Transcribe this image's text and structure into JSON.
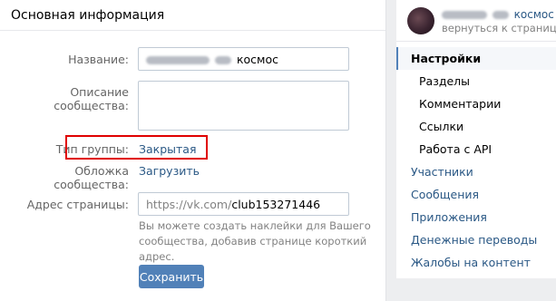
{
  "main": {
    "title": "Основная информация",
    "name_label": "Название:",
    "name_value_suffix": "космос",
    "description_label": "Описание сообщества:",
    "description_value": "",
    "group_type_label": "Тип группы:",
    "group_type_value": "Закрытая",
    "cover_label": "Обложка сообщества:",
    "cover_link": "Загрузить",
    "address_label": "Адрес страницы:",
    "address_prefix": "https://vk.com/",
    "address_value": "club153271446",
    "address_hint": "Вы можете создать наклейки для Вашего сообщества, добавив странице короткий адрес.",
    "save_label": "Сохранить"
  },
  "sidebar": {
    "community_name_suffix": "космос",
    "back_label": "вернуться к странице",
    "items": [
      {
        "label": "Настройки"
      },
      {
        "label": "Разделы"
      },
      {
        "label": "Комментарии"
      },
      {
        "label": "Ссылки"
      },
      {
        "label": "Работа с API"
      },
      {
        "label": "Участники"
      },
      {
        "label": "Сообщения"
      },
      {
        "label": "Приложения"
      },
      {
        "label": "Денежные переводы"
      },
      {
        "label": "Жалобы на контент"
      }
    ]
  },
  "colors": {
    "accent": "#5181b8",
    "link": "#2a5885",
    "highlight_border": "#e00000"
  }
}
